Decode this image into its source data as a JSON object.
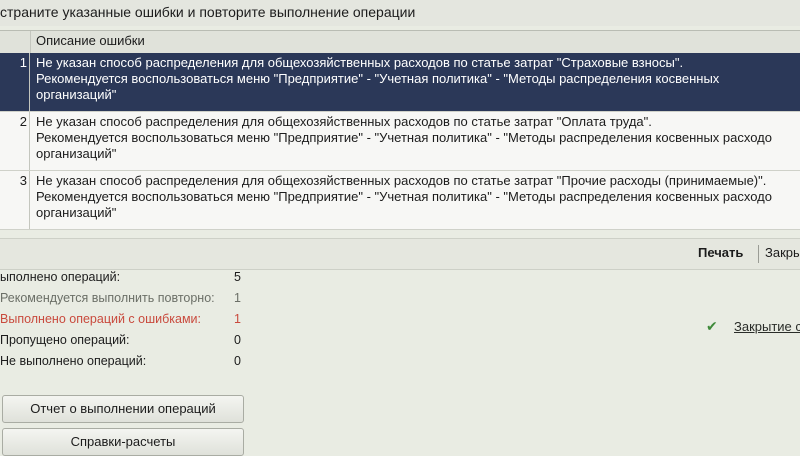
{
  "header": {
    "message": "страните указанные ошибки и повторите выполнение операции"
  },
  "errors_table": {
    "column_description": "Описание ошибки",
    "rows": [
      {
        "num": "1",
        "line1": "Не указан способ распределения для общехозяйственных расходов по статье затрат \"Страховые взносы\".",
        "line2": "Рекомендуется воспользоваться меню \"Предприятие\" - \"Учетная политика\" - \"Методы распределения косвенных",
        "line3": "организаций\""
      },
      {
        "num": "2",
        "line1": "Не указан способ распределения для общехозяйственных расходов по статье затрат \"Оплата труда\".",
        "line2": "Рекомендуется воспользоваться меню \"Предприятие\" - \"Учетная политика\" - \"Методы распределения косвенных расходо",
        "line3": "организаций\""
      },
      {
        "num": "3",
        "line1": "Не указан способ распределения для общехозяйственных расходов по статье затрат \"Прочие расходы (принимаемые)\".",
        "line2": "Рекомендуется воспользоваться меню \"Предприятие\" - \"Учетная политика\" - \"Методы распределения косвенных расходо",
        "line3": "организаций\""
      }
    ]
  },
  "toolbar": {
    "print_label": "Печать",
    "close_label": "Закры"
  },
  "stats": [
    {
      "label": "ыполнено операций:",
      "value": "5"
    },
    {
      "label": "Рекомендуется выполнить повторно:",
      "value": "1"
    },
    {
      "label": "Выполнено операций с ошибками:",
      "value": "1"
    },
    {
      "label": "Пропущено операций:",
      "value": "0"
    },
    {
      "label": "Не выполнено операций:",
      "value": "0"
    }
  ],
  "buttons": {
    "report": "Отчет о выполнении операций",
    "references": "Справки-расчеты"
  },
  "side_link": {
    "label": "Закрытие с"
  },
  "colors": {
    "selection": "#2b3858",
    "error_text": "#c94a3d",
    "check": "#3f8a3a"
  },
  "icons": {
    "check": "check-icon"
  }
}
